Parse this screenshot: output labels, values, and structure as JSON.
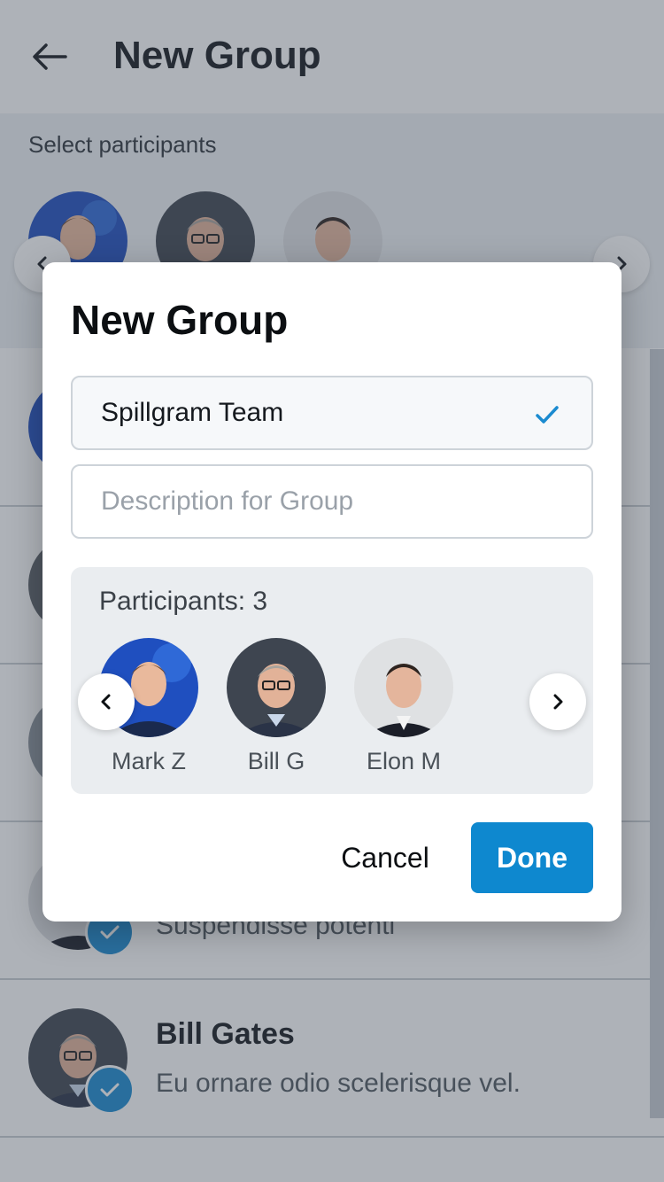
{
  "header": {
    "title": "New Group"
  },
  "select_bar": {
    "label": "Select participants",
    "avatars": [
      "Mark Z",
      "Bill G",
      "Elon M"
    ]
  },
  "list": [
    {
      "name": "",
      "subtitle": "",
      "selected": false
    },
    {
      "name": "",
      "subtitle": "",
      "selected": false
    },
    {
      "name": "",
      "subtitle": "",
      "selected": false
    },
    {
      "name": "",
      "subtitle": "Suspendisse potenti",
      "selected": true
    },
    {
      "name": "Bill Gates",
      "subtitle": "Eu ornare odio scelerisque vel.",
      "selected": true
    }
  ],
  "modal": {
    "title": "New Group",
    "group_name": "Spillgram Team",
    "description_placeholder": "Description for Group",
    "participants_label": "Participants: 3",
    "participants": [
      {
        "name": "Mark Z"
      },
      {
        "name": "Bill G"
      },
      {
        "name": "Elon M"
      }
    ],
    "cancel_label": "Cancel",
    "done_label": "Done"
  },
  "colors": {
    "accent": "#0e88cf",
    "overlay": "#3d4856",
    "panel": "#eaedf0"
  },
  "icons": [
    "arrow-left-icon",
    "chevron-left-icon",
    "chevron-right-icon",
    "check-icon"
  ]
}
